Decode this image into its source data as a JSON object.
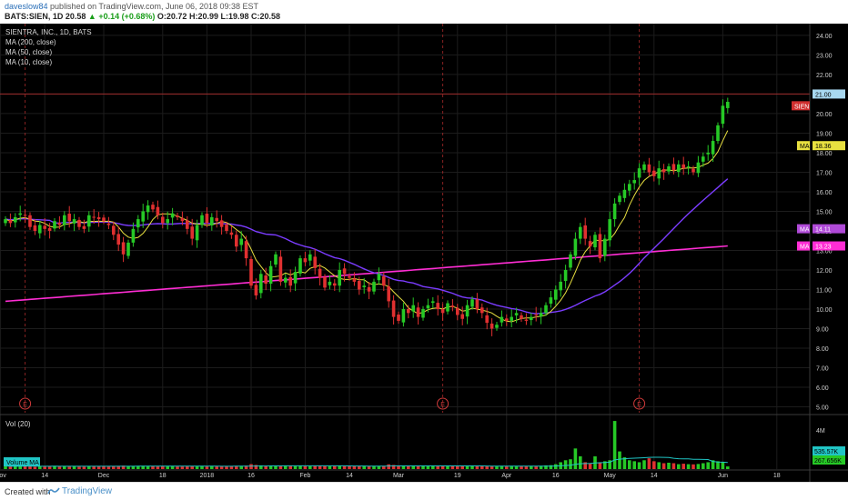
{
  "header": {
    "author": "daveslow84",
    "publish_text": "published on TradingView.com, June 06, 2018 09:38 EST",
    "symbol_line": "BATS:SIEN, 1D",
    "last": "20.58",
    "change": "+0.14 (+0.68%)",
    "open": "O:20.72",
    "high": "H:20.99",
    "low": "L:19.98",
    "close": "C:20.58"
  },
  "legend": {
    "symbol": "SIENTRA, INC., 1D, BATS",
    "ma1": "MA (200, close)",
    "ma2": "MA (50, close)",
    "ma3": "MA (10, close)",
    "vol": "Vol (20)",
    "volume_ma": "Volume MA"
  },
  "footer": {
    "created_with": "Created with",
    "brand": "TradingView"
  },
  "colors": {
    "background": "#000000",
    "grid": "#1c1c1c",
    "up": "#26c926",
    "down": "#e03030",
    "ma200": "#ff2dd4",
    "ma50": "#7b3cff",
    "ma10": "#e8e040",
    "vol_ma": "#20c5c5"
  },
  "chart_data": {
    "type": "candlestick",
    "ylim": [
      4.7,
      24.6
    ],
    "y_ticks": [
      "24.00",
      "23.00",
      "22.00",
      "21.00",
      "20.00",
      "19.00",
      "18.00",
      "17.00",
      "16.00",
      "15.00",
      "14.00",
      "13.00",
      "12.00",
      "11.00",
      "10.00",
      "9.00",
      "8.00",
      "7.00",
      "6.00",
      "5.00"
    ],
    "x_ticks": [
      {
        "label": "Nov",
        "i": -1
      },
      {
        "label": "14",
        "i": 8
      },
      {
        "label": "Dec",
        "i": 20
      },
      {
        "label": "18",
        "i": 32
      },
      {
        "label": "2018",
        "i": 41
      },
      {
        "label": "16",
        "i": 50
      },
      {
        "label": "Feb",
        "i": 61
      },
      {
        "label": "14",
        "i": 70
      },
      {
        "label": "Mar",
        "i": 80
      },
      {
        "label": "19",
        "i": 92
      },
      {
        "label": "Apr",
        "i": 102
      },
      {
        "label": "16",
        "i": 112
      },
      {
        "label": "May",
        "i": 123
      },
      {
        "label": "14",
        "i": 132
      },
      {
        "label": "Jun",
        "i": 146
      },
      {
        "label": "18",
        "i": 157
      }
    ],
    "earnings_markers": [
      4,
      89,
      129
    ],
    "earnings_label": "E",
    "price_labels": {
      "last": {
        "text": "21.00",
        "value": 21.0
      },
      "symbol": {
        "text": "SIEN",
        "value": 20.4
      },
      "ma10": {
        "text": "MA",
        "value_text": "18.36",
        "value": 18.36
      },
      "ma50": {
        "text": "MA",
        "value_text": "14.11",
        "value": 14.11
      },
      "ma200": {
        "text": "MA",
        "value_text": "13.23",
        "value": 13.23
      }
    },
    "volume_ticks": [
      "4M"
    ],
    "volume_labels": {
      "vol_ma": "535.57K",
      "vol": "267.656K"
    },
    "vol_ylim": [
      0,
      5000000
    ],
    "closes": [
      14.6,
      14.4,
      14.7,
      14.9,
      14.8,
      14.2,
      14.0,
      14.3,
      14.1,
      14.0,
      14.5,
      14.3,
      14.8,
      14.5,
      14.6,
      14.2,
      14.1,
      14.8,
      14.7,
      14.6,
      14.5,
      14.3,
      13.8,
      13.3,
      12.8,
      13.4,
      14.1,
      14.6,
      15.0,
      15.3,
      15.1,
      14.8,
      14.4,
      14.6,
      14.9,
      14.7,
      14.5,
      14.1,
      13.6,
      14.3,
      14.8,
      14.4,
      14.7,
      14.5,
      14.2,
      14.0,
      13.8,
      13.2,
      13.6,
      12.6,
      11.2,
      10.7,
      11.8,
      11.3,
      12.2,
      12.8,
      11.4,
      11.6,
      11.2,
      11.9,
      12.6,
      12.4,
      12.8,
      12.1,
      11.6,
      11.1,
      11.4,
      11.2,
      12.0,
      11.8,
      11.6,
      11.4,
      11.0,
      11.2,
      10.9,
      11.4,
      11.8,
      11.2,
      10.4,
      9.6,
      9.4,
      10.0,
      9.8,
      10.2,
      9.6,
      10.0,
      10.2,
      10.4,
      10.0,
      9.8,
      10.3,
      10.1,
      9.7,
      9.5,
      10.2,
      10.5,
      10.0,
      9.8,
      9.3,
      9.0,
      9.2,
      9.6,
      9.4,
      9.6,
      9.8,
      9.5,
      9.4,
      9.6,
      9.7,
      9.8,
      10.2,
      10.6,
      11.0,
      11.4,
      12.0,
      12.8,
      13.6,
      14.2,
      13.6,
      13.2,
      13.8,
      12.6,
      13.6,
      14.6,
      15.4,
      15.8,
      16.1,
      16.4,
      16.6,
      17.2,
      17.4,
      17.0,
      16.8,
      17.2,
      17.0,
      17.3,
      17.1,
      17.4,
      17.2,
      17.3,
      17.0,
      17.5,
      17.8,
      18.0,
      18.6,
      19.4,
      20.4,
      20.6
    ],
    "volumes": [
      320000,
      260000,
      300000,
      280000,
      350000,
      300000,
      240000,
      280000,
      260000,
      300000,
      320000,
      280000,
      300000,
      270000,
      290000,
      260000,
      250000,
      300000,
      280000,
      320000,
      280000,
      260000,
      300000,
      330000,
      350000,
      300000,
      290000,
      310000,
      330000,
      320000,
      290000,
      270000,
      280000,
      300000,
      280000,
      270000,
      260000,
      290000,
      320000,
      300000,
      280000,
      300000,
      290000,
      280000,
      270000,
      300000,
      290000,
      330000,
      320000,
      350000,
      500000,
      420000,
      380000,
      340000,
      320000,
      330000,
      360000,
      340000,
      320000,
      300000,
      330000,
      300000,
      290000,
      310000,
      320000,
      300000,
      290000,
      310000,
      330000,
      300000,
      290000,
      280000,
      300000,
      290000,
      310000,
      320000,
      300000,
      330000,
      480000,
      420000,
      380000,
      350000,
      330000,
      300000,
      320000,
      310000,
      300000,
      290000,
      300000,
      310000,
      290000,
      300000,
      280000,
      300000,
      290000,
      300000,
      290000,
      280000,
      310000,
      300000,
      290000,
      280000,
      300000,
      290000,
      280000,
      300000,
      290000,
      310000,
      320000,
      330000,
      380000,
      400000,
      500000,
      700000,
      900000,
      1000000,
      2100000,
      1300000,
      700000,
      600000,
      1300000,
      700000,
      800000,
      900000,
      4900000,
      1800000,
      1200000,
      900000,
      800000,
      700000,
      900000,
      1100000,
      800000,
      700000,
      600000,
      650000,
      600000,
      500000,
      550000,
      500000,
      480000,
      520000,
      600000,
      700000,
      900000,
      800000,
      700000,
      270000
    ]
  }
}
